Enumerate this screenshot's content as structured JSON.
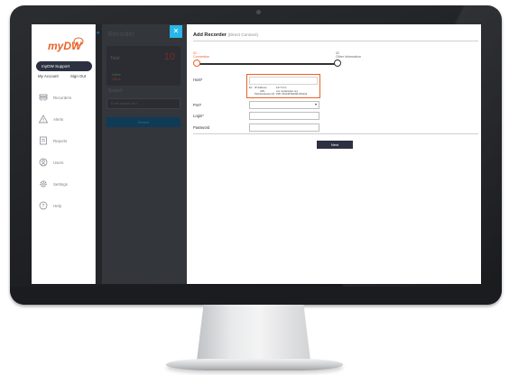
{
  "app": {
    "logo_text": "myDW",
    "brand_color": "#e8622a"
  },
  "nav": {
    "user_label": "myDW Support",
    "my_account": "My Account",
    "sign_out": "Sign Out",
    "items": [
      {
        "label": "Recorders",
        "icon": "recorder-icon"
      },
      {
        "label": "Alerts",
        "icon": "alert-icon"
      },
      {
        "label": "Reports",
        "icon": "report-icon"
      },
      {
        "label": "Users",
        "icon": "user-icon"
      },
      {
        "label": "Settings",
        "icon": "gear-icon"
      },
      {
        "label": "Help",
        "icon": "help-icon"
      }
    ]
  },
  "panel": {
    "title": "Recorder",
    "close_glyph": "✕",
    "collapse_glyph": "«",
    "total_label": "Total",
    "total_value": "10",
    "online_label": "Online",
    "offline_label": "Offline",
    "search_label": "Search",
    "search_placeholder": "Enter search text",
    "search_button": "Search"
  },
  "main": {
    "title": "Add Recorder",
    "subtitle": "(Direct Connect)",
    "steps": [
      {
        "number": "01",
        "label": "Connection",
        "active": true
      },
      {
        "number": "02",
        "label": "Other Information",
        "active": false
      }
    ],
    "fields": {
      "host_label": "Host*",
      "port_label": "Port*",
      "login_label": "Login*",
      "password_label": "Password"
    },
    "host_hint": {
      "prefix": "Ex:",
      "ip_label": "IP Address",
      "ip_value": "127.0.0.1",
      "url_label": "URL",
      "url_value": "xxx.mydwvideo.net",
      "pn_label": "Part/Hostname ID",
      "pn_value": "P2P-4124367EFAB-001122"
    },
    "next_button": "Next"
  }
}
